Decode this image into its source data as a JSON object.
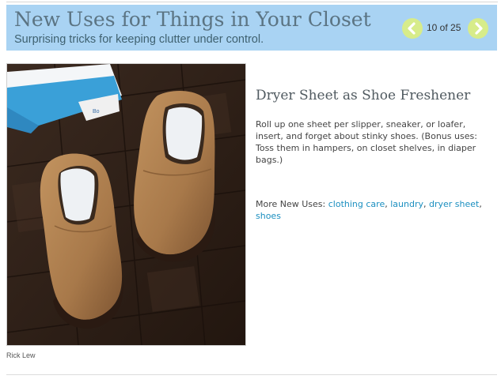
{
  "header": {
    "title": "New Uses for Things in Your Closet",
    "subtitle": "Surprising tricks for keeping clutter under control.",
    "counter": "10 of 25",
    "prev_icon": "chevron-left-icon",
    "next_icon": "chevron-right-icon",
    "background_color": "#a9d3f3",
    "button_color": "#d7ec8a"
  },
  "photo": {
    "subject": "shoes-with-dryer-sheets",
    "credit": "Rick Lew"
  },
  "item": {
    "title": "Dryer Sheet as Shoe Freshener",
    "description": "Roll up one sheet per slipper, sneaker, or loafer, insert, and forget about stinky shoes. (Bonus uses: Toss them in hampers, on closet shelves, in diaper bags.)"
  },
  "more_uses": {
    "label": "More New Uses:",
    "links": [
      "clothing care",
      "laundry",
      "dryer sheet",
      "shoes"
    ],
    "link_color": "#1b8fc0"
  }
}
